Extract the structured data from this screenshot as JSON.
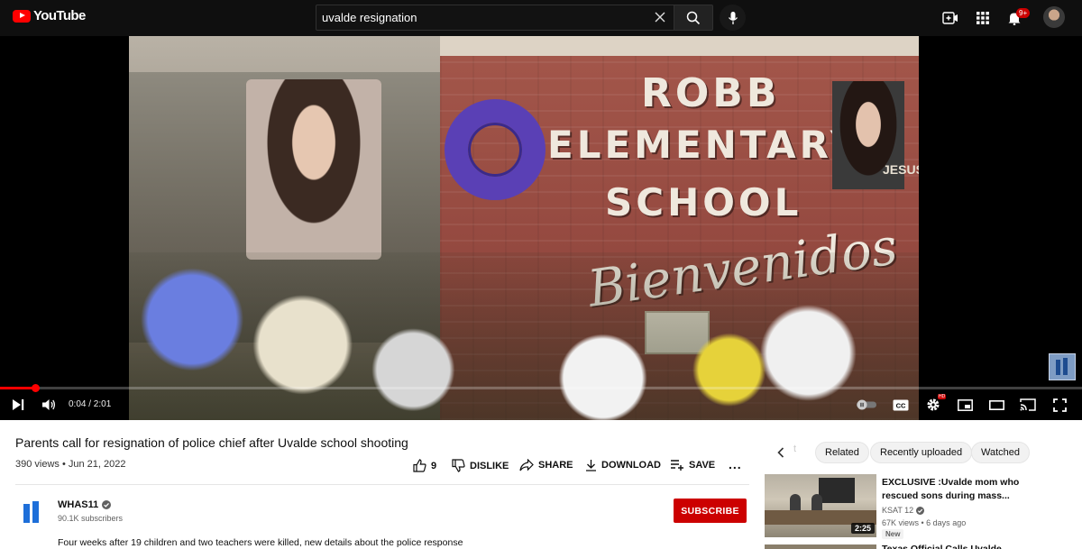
{
  "header": {
    "logo_text": "YouTube",
    "search_value": "uvalde resignation",
    "notification_count": "9+"
  },
  "video": {
    "sign_lines": [
      "ROBB",
      "ELEMENTARY",
      "SCHOOL",
      "Bienvenidos"
    ],
    "sign_side_text": "JESUS",
    "current_time": "0:04",
    "duration": "2:01",
    "time_display": "0:04 / 2:01",
    "progress_percent": 3.3,
    "hd_badge": "HD",
    "cc_label": "CC"
  },
  "details": {
    "title": "Parents call for resignation of police chief after Uvalde school shooting",
    "meta": "390 views • Jun 21, 2022",
    "actions": {
      "like_count": "9",
      "dislike": "DISLIKE",
      "share": "SHARE",
      "download": "DOWNLOAD",
      "save": "SAVE",
      "more": "..."
    }
  },
  "channel": {
    "name": "WHAS11",
    "subscribers": "90.1K subscribers",
    "subscribe_label": "SUBSCRIBE",
    "description": "Four weeks after 19 children and two teachers were killed, new details about the police response"
  },
  "sidebar": {
    "chips": [
      "Related",
      "Recently uploaded",
      "Watched"
    ],
    "faded_chip": "t",
    "related": [
      {
        "title": "EXCLUSIVE :Uvalde mom who rescued sons during mass...",
        "channel": "KSAT 12",
        "meta": "67K views • 6 days ago",
        "badge": "New",
        "duration": "2:25"
      },
      {
        "title": "Texas Official Calls Uvalde..."
      }
    ]
  },
  "colors": {
    "brand_red": "#ff0000",
    "subscribe_red": "#cc0000",
    "topbar": "#0f0f0f"
  }
}
